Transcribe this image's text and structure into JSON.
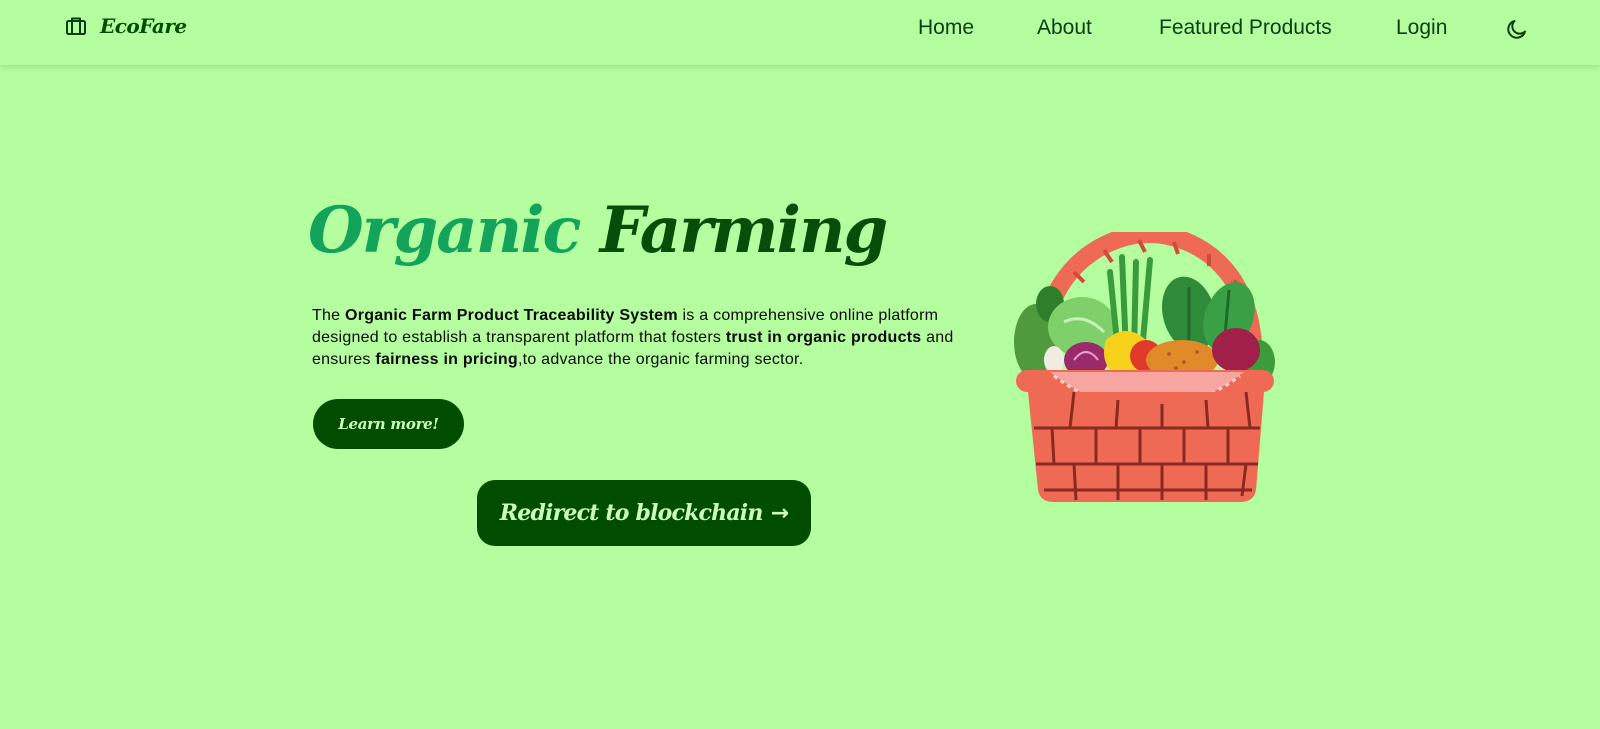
{
  "header": {
    "brand": {
      "name": "EcoFare",
      "icon": "briefcase-icon"
    },
    "nav": [
      {
        "label": "Home"
      },
      {
        "label": "About"
      },
      {
        "label": "Featured Products"
      },
      {
        "label": "Login"
      }
    ],
    "theme_toggle_icon": "moon-icon"
  },
  "hero": {
    "title_part1": "Organic",
    "title_part2": "Farming",
    "description": {
      "t1": "The ",
      "b1": "Organic Farm Product Traceability System",
      "t2": " is a comprehensive online platform designed to establish a transparent platform that fosters ",
      "b2": "trust in organic products",
      "t3": " and ensures ",
      "b3": "fairness in pricing",
      "t4": ",to advance the organic farming sector."
    },
    "learn_more_label": "Learn more!",
    "redirect_label": "Redirect to blockchain",
    "redirect_icon": "arrow-right-icon",
    "illustration": "vegetable-basket-illustration"
  },
  "colors": {
    "background": "#b4fe9f",
    "button": "#004d00",
    "button_text": "#ccffbe",
    "title_accent": "#13a35a",
    "title_dark": "#074d0a"
  }
}
